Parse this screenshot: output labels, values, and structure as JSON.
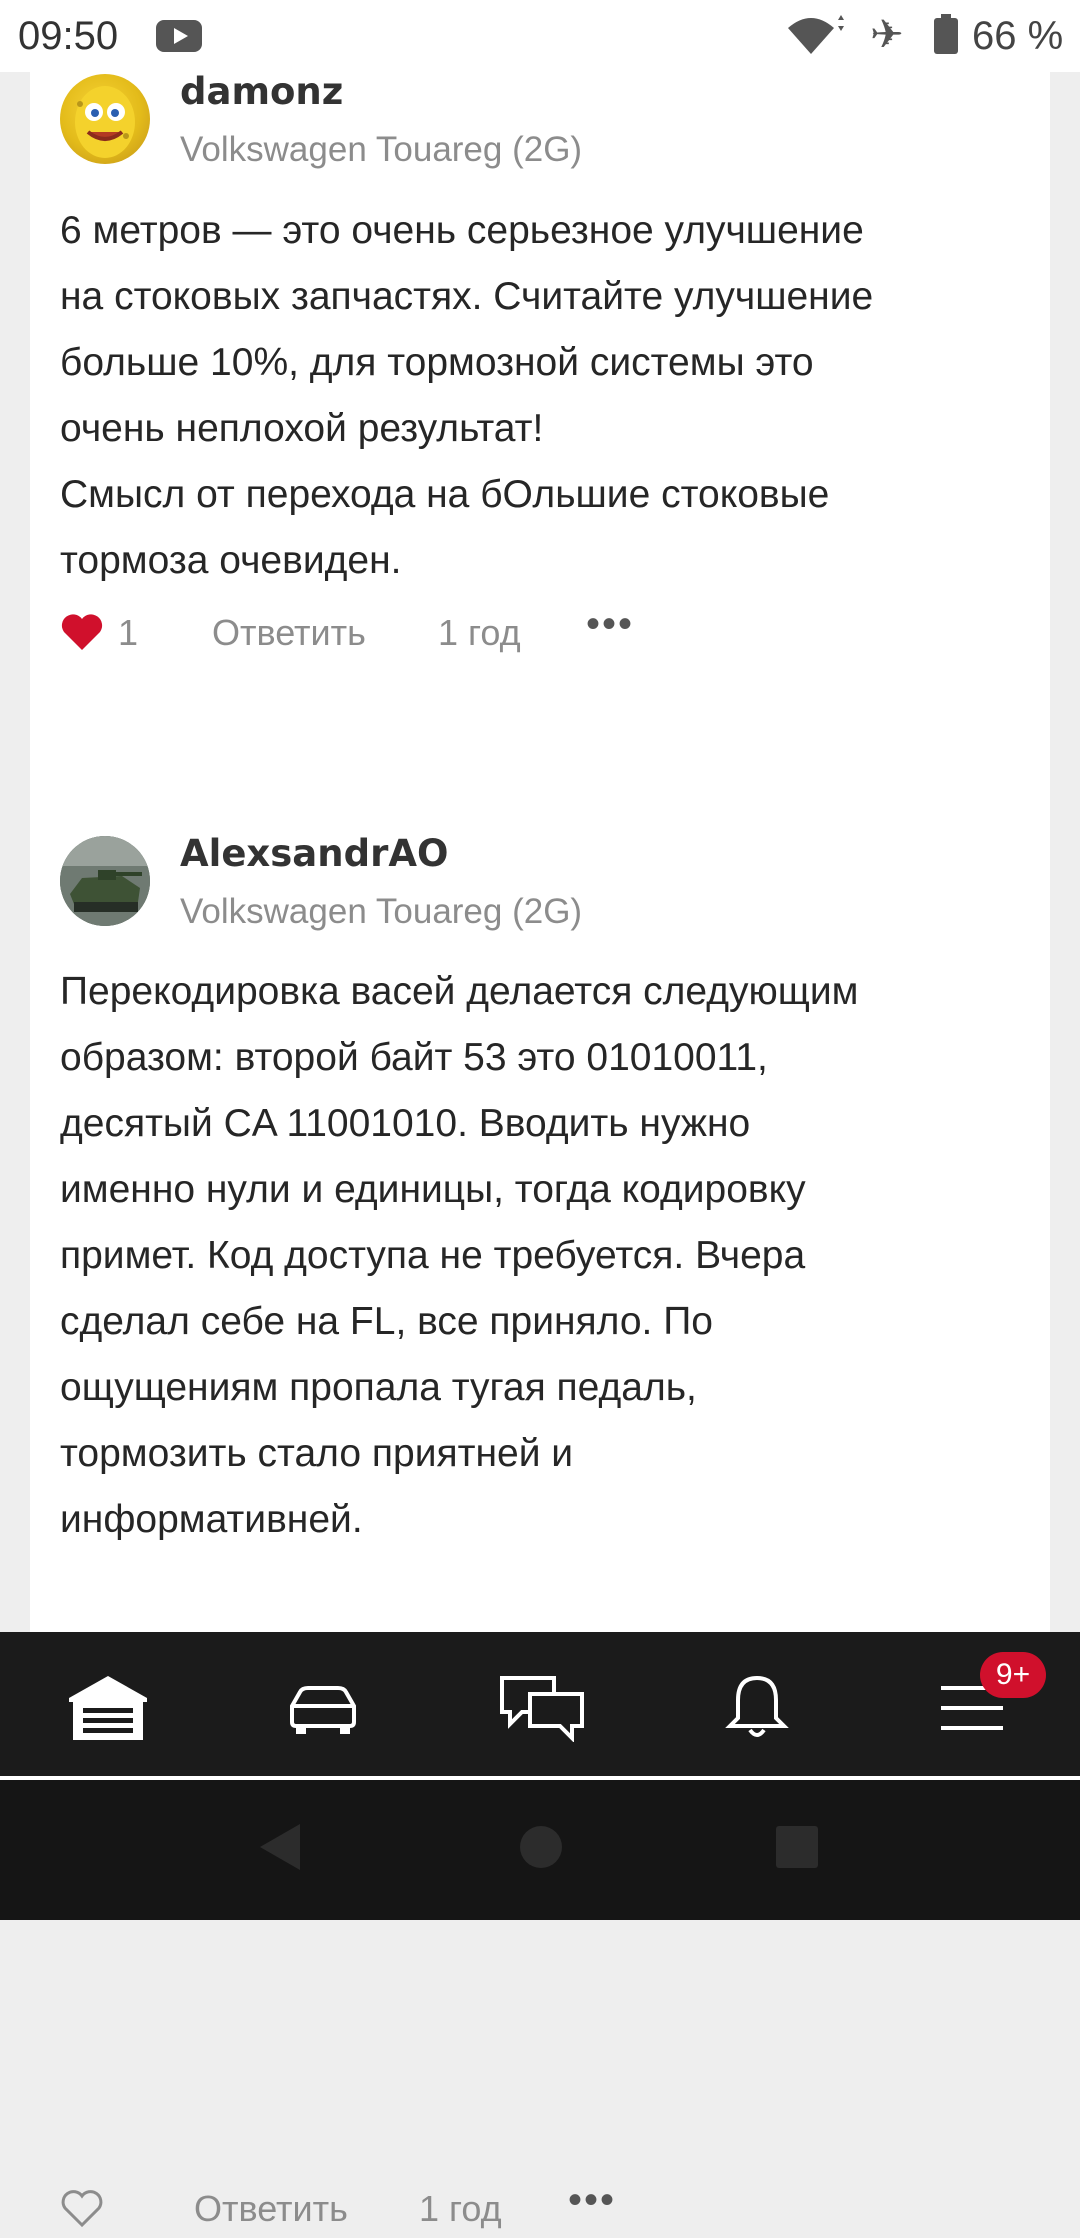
{
  "status_bar": {
    "time": "09:50",
    "battery_percent": "66 %",
    "icons": [
      "youtube-icon",
      "wifi-icon",
      "airplane-icon",
      "battery-icon"
    ]
  },
  "comments": [
    {
      "author": "damonz",
      "car": "Volkswagen Touareg (2G)",
      "text": "6 метров — это очень серьезное улучшение\nна стоковых запчастях. Считайте улучшение\nбольше 10%, для тормозной системы это\nочень неплохой результат!\nСмысл от перехода на бОльшие стоковые\nтормоза очевиден.",
      "likes": "1",
      "liked": true,
      "reply_label": "Ответить",
      "time": "1 год",
      "more": "•••"
    },
    {
      "author": "AlexsandrAO",
      "car": "Volkswagen Touareg (2G)",
      "text": "Перекодировка васей делается следующим\nобразом: второй байт 53 это 01010011,\nдесятый CA 11001010. Вводить нужно\nименно нули и единицы, тогда кодировку\nпримет. Код доступа не требуется. Вчера\nсделал себе на FL, все приняло. По\nощущениям пропала тугая педаль,\nтормозить стало приятней и\nинформативней.",
      "likes": "",
      "liked": false,
      "reply_label": "Ответить",
      "time": "1 год",
      "more": "•••"
    }
  ],
  "bottom_nav": {
    "items": [
      "garage-icon",
      "car-icon",
      "chat-icon",
      "bell-icon",
      "menu-icon"
    ],
    "menu_badge": "9+",
    "badge_color": "#d0102c"
  },
  "colors": {
    "liked_heart": "#d0102c",
    "nav_background": "#1b1b1b"
  }
}
